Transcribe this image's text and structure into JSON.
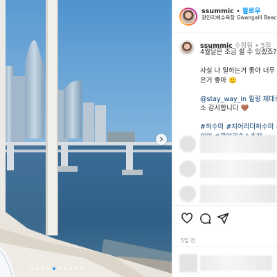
{
  "post_header": {
    "username": "ssummic",
    "separator": "•",
    "follow_label": "팔로우",
    "location": "광안리해수욕장 Gwangalli Beach, Busan Korea 廣安里海水浴場"
  },
  "caption": {
    "username": "ssummic",
    "meta": "수정됨 • 5일",
    "lines": [
      "4월달은 조금 쉴 수 있겠죠?",
      "",
      "사실 나 일하는거 좋아 너무",
      "은거 좋아 🙂",
      "",
      "@stay_way_in 힐링 제대로 ",
      "소 감사합니다 🤎",
      "",
      "#허수미 #지어리더허수미 #",
      "이인 #광안리숙소추천"
    ],
    "mention": "@stay_way_in"
  },
  "timestamp": "5일 전",
  "icons": {
    "like": "heart-icon",
    "comment": "comment-icon",
    "share": "send-icon",
    "next": "chevron-right-icon"
  },
  "carousel": {
    "total": 10,
    "active_index": 4
  },
  "colors": {
    "link_blue": "#0095f6",
    "hashtag_blue": "#00376b",
    "muted": "#8e8e8e",
    "active_dot": "#3897f0"
  }
}
